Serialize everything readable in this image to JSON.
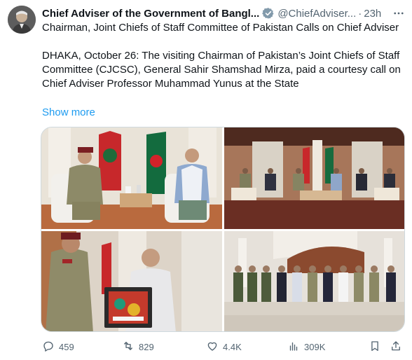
{
  "tweet": {
    "author_name": "Chief Adviser of the Government of Bangl...",
    "handle": "@ChiefAdviser...",
    "separator": "·",
    "time": "23h",
    "headline": "Chairman, Joint Chiefs of Staff Committee of Pakistan Calls on Chief Adviser",
    "body": "DHAKA, October 26: The visiting Chairman of Pakistan’s Joint Chiefs of Staff Committee (CJCSC), General Sahir Shamshad Mirza, paid a courtesy call on Chief Adviser Professor Muhammad Yunus at the State",
    "show_more": "Show more"
  },
  "actions": {
    "replies": "459",
    "reposts": "829",
    "likes": "4.4K",
    "views": "309K"
  },
  "icons": {
    "verified": "verified-badge-icon",
    "more": "more-options-icon",
    "reply": "reply-icon",
    "repost": "repost-icon",
    "like": "heart-icon",
    "views": "views-chart-icon",
    "bookmark": "bookmark-icon",
    "share": "share-icon"
  },
  "colors": {
    "accent": "#1d9bf0",
    "muted": "#536471",
    "text": "#0f1419",
    "border": "#cfd9de"
  }
}
